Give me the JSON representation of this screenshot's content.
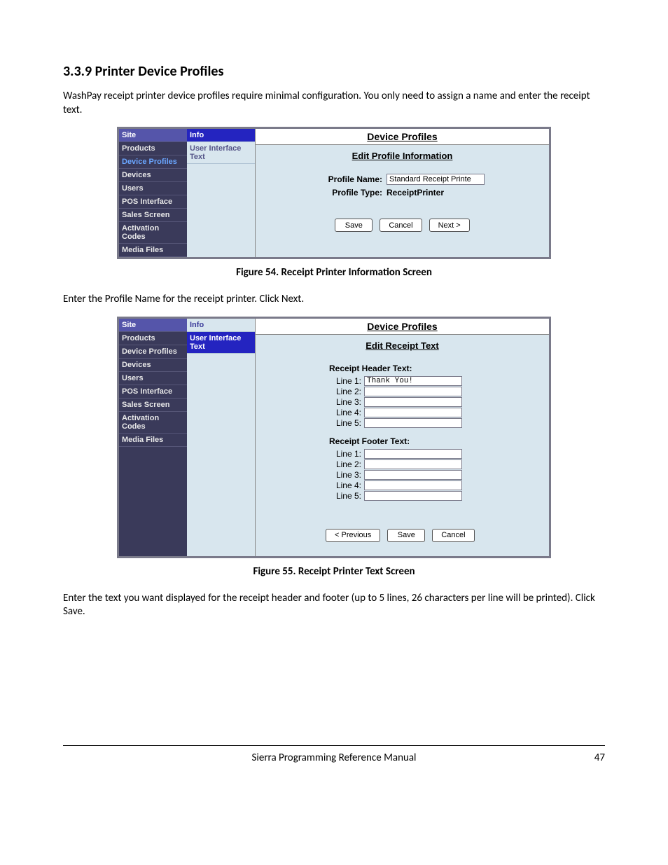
{
  "heading": "3.3.9  Printer Device Profiles",
  "intro": "WashPay receipt printer device profiles require minimal configuration. You only need to assign a name and enter the receipt text.",
  "figure54": {
    "caption": "Figure 54. Receipt Printer Information Screen",
    "nav": [
      "Site",
      "Products",
      "Device Profiles",
      "Devices",
      "Users",
      "POS Interface",
      "Sales Screen",
      "Activation Codes",
      "Media Files"
    ],
    "subnav": [
      "Info",
      "User Interface Text"
    ],
    "title": "Device Profiles",
    "subtitle": "Edit Profile Information",
    "profile_name_label": "Profile Name:",
    "profile_name_value": "Standard Receipt Printe",
    "profile_type_label": "Profile Type:",
    "profile_type_value": "ReceiptPrinter",
    "buttons": {
      "save": "Save",
      "cancel": "Cancel",
      "next": "Next >"
    }
  },
  "instruction1": "Enter the Profile Name for the receipt printer. Click Next.",
  "figure55": {
    "caption": "Figure 55. Receipt Printer Text Screen",
    "nav": [
      "Site",
      "Products",
      "Device Profiles",
      "Devices",
      "Users",
      "POS Interface",
      "Sales Screen",
      "Activation Codes",
      "Media Files"
    ],
    "subnav": [
      "Info",
      "User Interface Text"
    ],
    "title": "Device Profiles",
    "subtitle": "Edit Receipt Text",
    "header_label": "Receipt Header Text:",
    "footer_label": "Receipt Footer Text:",
    "lines": {
      "l1": "Line 1:",
      "l2": "Line 2:",
      "l3": "Line 3:",
      "l4": "Line 4:",
      "l5": "Line 5:"
    },
    "header_values": {
      "l1": "Thank You!",
      "l2": "",
      "l3": "",
      "l4": "",
      "l5": ""
    },
    "footer_values": {
      "l1": "",
      "l2": "",
      "l3": "",
      "l4": "",
      "l5": ""
    },
    "buttons": {
      "prev": "< Previous",
      "save": "Save",
      "cancel": "Cancel"
    }
  },
  "instruction2": "Enter the text you want displayed for the receipt header and footer (up to 5 lines, 26 characters per line will be printed). Click Save.",
  "footer": {
    "doc": "Sierra Programming Reference Manual",
    "page": "47"
  }
}
